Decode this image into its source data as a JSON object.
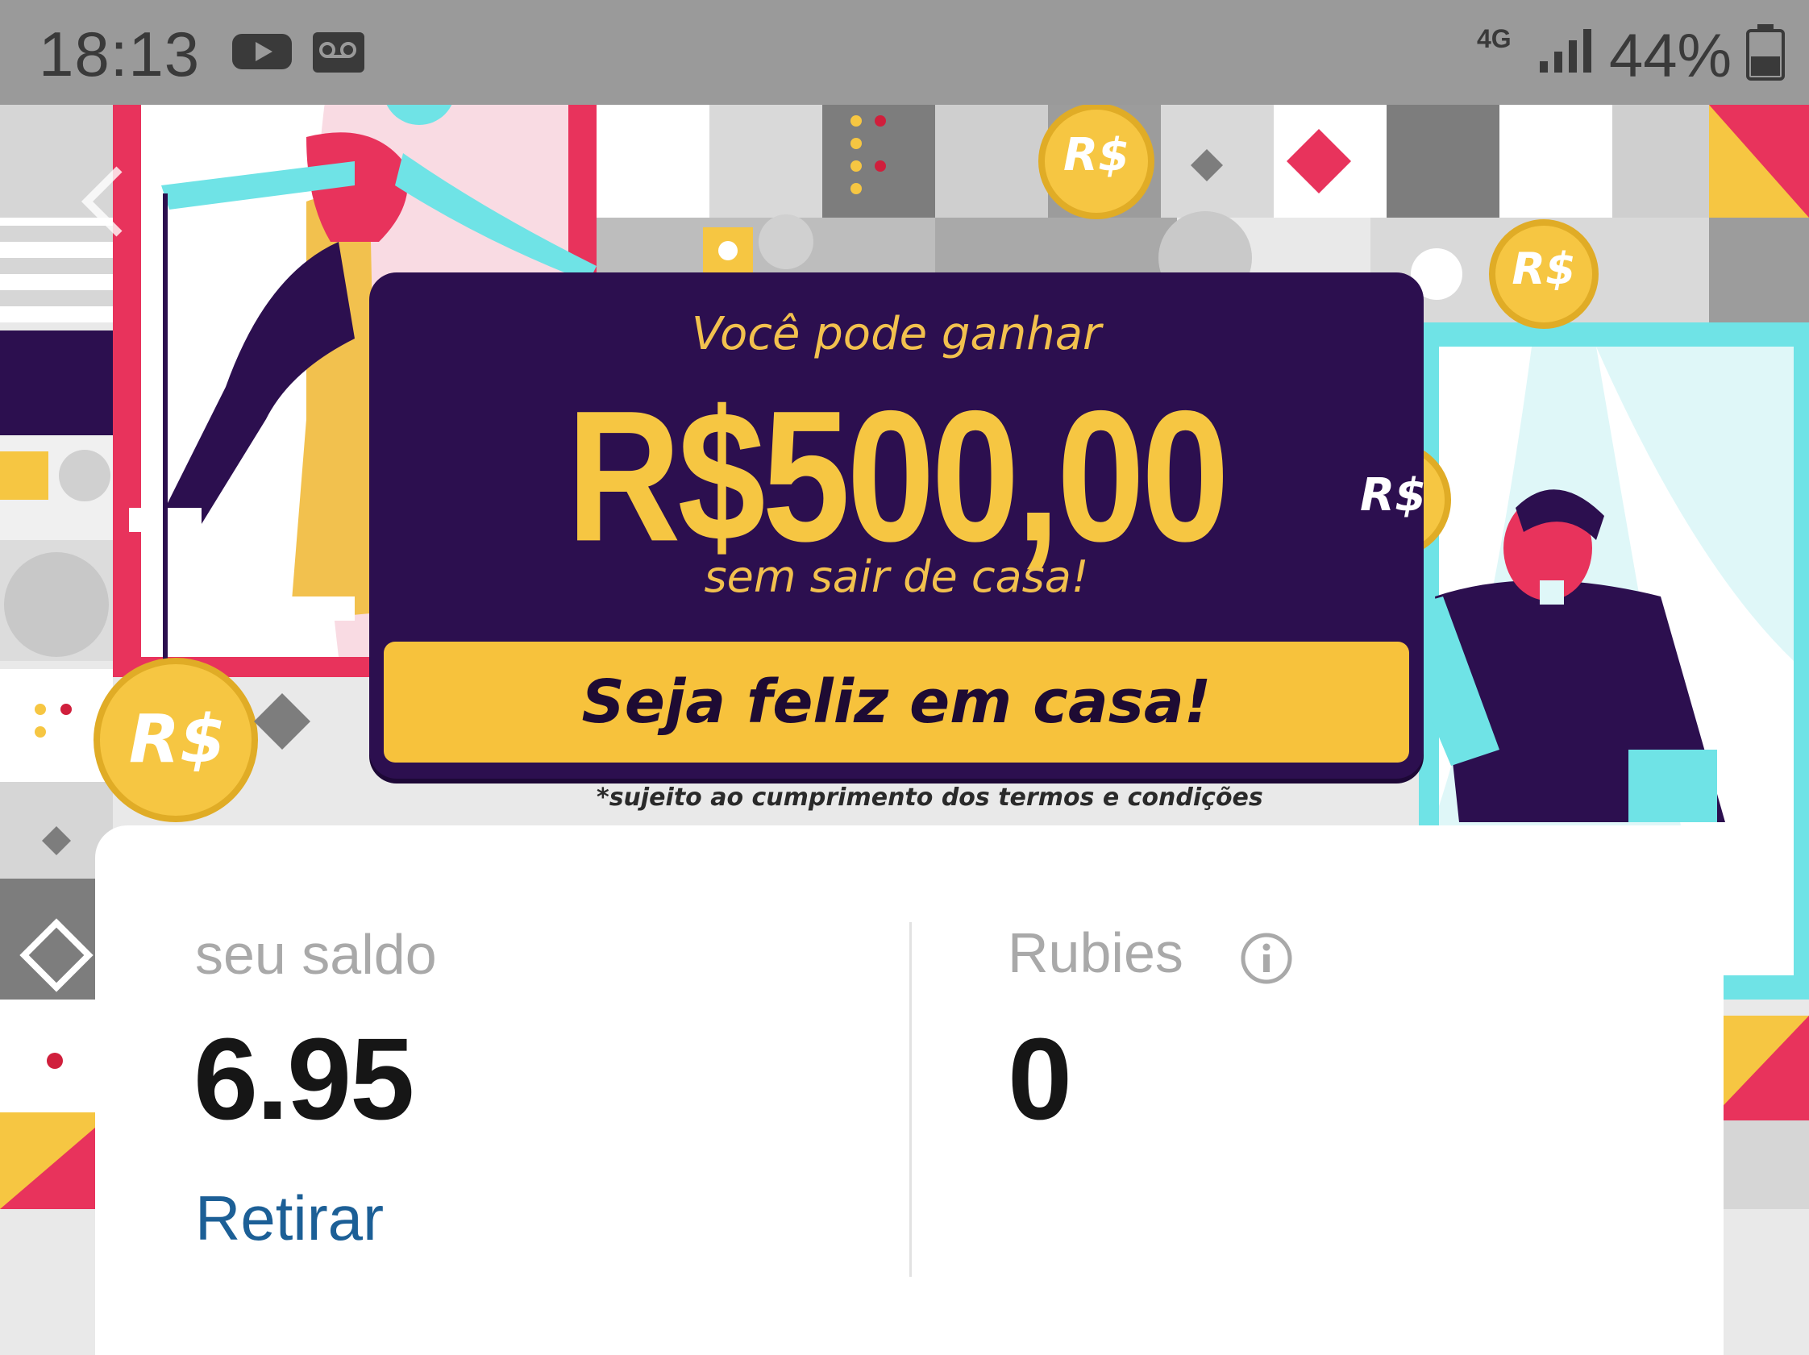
{
  "status_bar": {
    "time": "18:13",
    "network": "4G",
    "battery": "44%",
    "icons": [
      "youtube-icon",
      "voicemail-icon",
      "signal-icon",
      "battery-icon"
    ]
  },
  "banner": {
    "top_text": "Você pode ganhar",
    "amount": "R$500,00",
    "subtitle": "sem sair de casa!",
    "cta_label": "Seja feliz em casa!",
    "disclaimer": "*sujeito ao cumprimento dos termos e condições",
    "coin_label": "R$"
  },
  "balance_card": {
    "balance_label": "seu saldo",
    "balance_value": "6.95",
    "withdraw_label": "Retirar",
    "rubies_label": "Rubies",
    "rubies_value": "0"
  },
  "colors": {
    "banner_bg": "#2c0f4f",
    "gold": "#f6c642",
    "link_blue": "#1c5f96",
    "pink": "#e8335c",
    "teal": "#6fe3e6"
  }
}
